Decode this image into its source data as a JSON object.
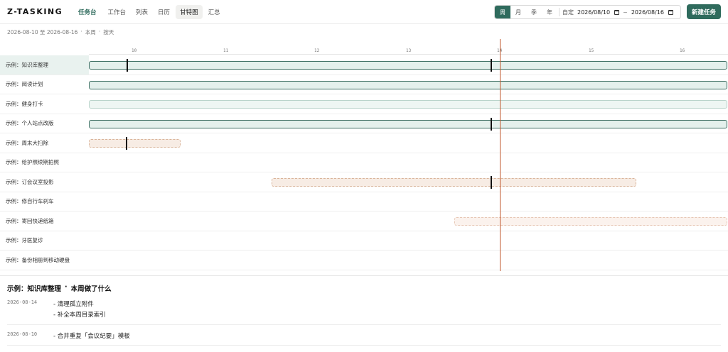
{
  "header": {
    "logo": "Z-TASKING",
    "nav": [
      "任务台",
      "工作台",
      "列表",
      "日历",
      "甘特图",
      "汇总"
    ],
    "active_nav": "甘特图",
    "range_tabs": [
      "周",
      "月",
      "季",
      "年"
    ],
    "active_range": "周",
    "custom_label": "自定",
    "start_date": "2026/08/10",
    "end_date": "2026/08/16",
    "date_separator": "~",
    "new_task_button": "新建任务"
  },
  "subheader": {
    "range": "2026-08-10 至 2026-08-16",
    "dot1": "·",
    "scope": "本周",
    "dot2": "·",
    "days": "按天"
  },
  "gantt": {
    "axis_ticks": [
      "10",
      "11",
      "12",
      "13",
      "14",
      "15",
      "16"
    ],
    "rows": [
      {
        "label": "示例：知识库整理",
        "selected": true
      },
      {
        "label": "示例：阅读计划",
        "selected": false
      },
      {
        "label": "示例：健身打卡",
        "selected": false
      },
      {
        "label": "示例：个人站点改版",
        "selected": false
      },
      {
        "label": "示例：周末大扫除",
        "selected": false
      },
      {
        "label": "示例：给护照续期拍照",
        "selected": false
      },
      {
        "label": "示例：订会议室投影",
        "selected": false
      },
      {
        "label": "示例：修自行车刹车",
        "selected": false
      },
      {
        "label": "示例：寄回快递纸箱",
        "selected": false
      },
      {
        "label": "示例：牙医复诊",
        "selected": false
      },
      {
        "label": "示例：备份相册到移动硬盘",
        "selected": false
      }
    ]
  },
  "summary": {
    "task": "示例：知识库整理",
    "dot": "·",
    "heading": "本周做了什么",
    "entries": [
      {
        "date": "2026-08-14",
        "items": [
          "- 清理孤立附件",
          "- 补全本周目录索引"
        ]
      },
      {
        "date": "2026-08-10",
        "items": [
          "- 合并重复「会议纪要」模板"
        ]
      }
    ]
  },
  "colors": {
    "accent": "#2f6b5d",
    "today_line": "#c0582e",
    "selected_row": "#e9f2ef"
  }
}
